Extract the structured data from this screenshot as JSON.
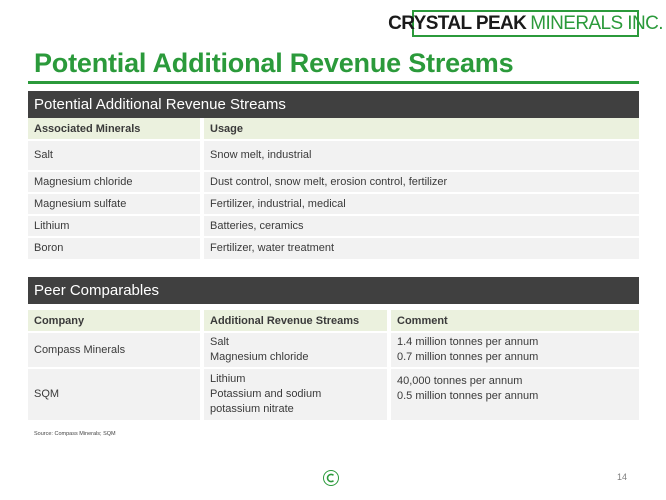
{
  "header": {
    "logo_bold": "CRYSTAL PEAK",
    "logo_light": "MINERALS INC.",
    "title": "Potential Additional Revenue Streams"
  },
  "revenue_section": {
    "heading": "Potential Additional Revenue Streams",
    "columns": [
      "Associated Minerals",
      "Usage"
    ],
    "rows": [
      {
        "mineral": "Salt",
        "usage": "Snow melt, industrial"
      },
      {
        "mineral": "Magnesium chloride",
        "usage": "Dust control, snow melt, erosion control, fertilizer"
      },
      {
        "mineral": "Magnesium sulfate",
        "usage": "Fertilizer, industrial, medical"
      },
      {
        "mineral": "Lithium",
        "usage": "Batteries, ceramics"
      },
      {
        "mineral": "Boron",
        "usage": "Fertilizer, water treatment"
      }
    ]
  },
  "peer_section": {
    "heading": "Peer Comparables",
    "columns": [
      "Company",
      "Additional Revenue Streams",
      "Comment"
    ],
    "rows": [
      {
        "company": "Compass Minerals",
        "streams": [
          "Salt",
          "Magnesium chloride"
        ],
        "comments": [
          "1.4 million tonnes per annum",
          "0.7 million tonnes per annum"
        ]
      },
      {
        "company": "SQM",
        "streams": [
          "Lithium",
          "Potassium and sodium",
          "potassium nitrate"
        ],
        "comments": [
          "40,000 tonnes per annum",
          "0.5 million tonnes per annum"
        ]
      }
    ]
  },
  "footer": {
    "source": "Source: Compass Minerals; SQM",
    "page_number": "14",
    "accent_color": "#2b9a3b"
  }
}
